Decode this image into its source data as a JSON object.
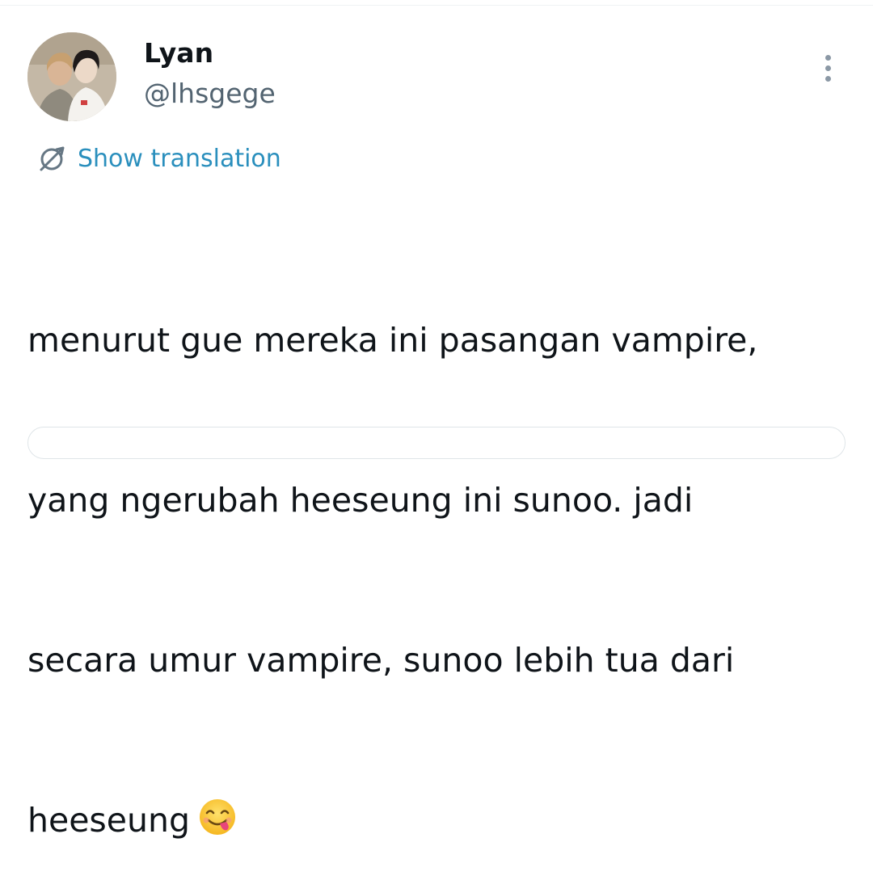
{
  "author": {
    "display_name": "Lyan",
    "handle": "@lhsgege",
    "avatar_icon": "profile-photo"
  },
  "menu": {
    "more_icon": "more-vertical-icon"
  },
  "translation": {
    "icon": "translate-icon",
    "label": "Show translation",
    "color": "#2a8fbd"
  },
  "tweet": {
    "lines": [
      "menurut gue mereka ini pasangan vampire,",
      "yang ngerubah heeseung ini sunoo. jadi",
      "secara umur vampire, sunoo lebih tua dari",
      "heeseung"
    ],
    "emoji": "face-savoring-food-emoji"
  },
  "colors": {
    "text": "#0f1419",
    "secondary": "#536471",
    "divider": "#eff3f4"
  }
}
